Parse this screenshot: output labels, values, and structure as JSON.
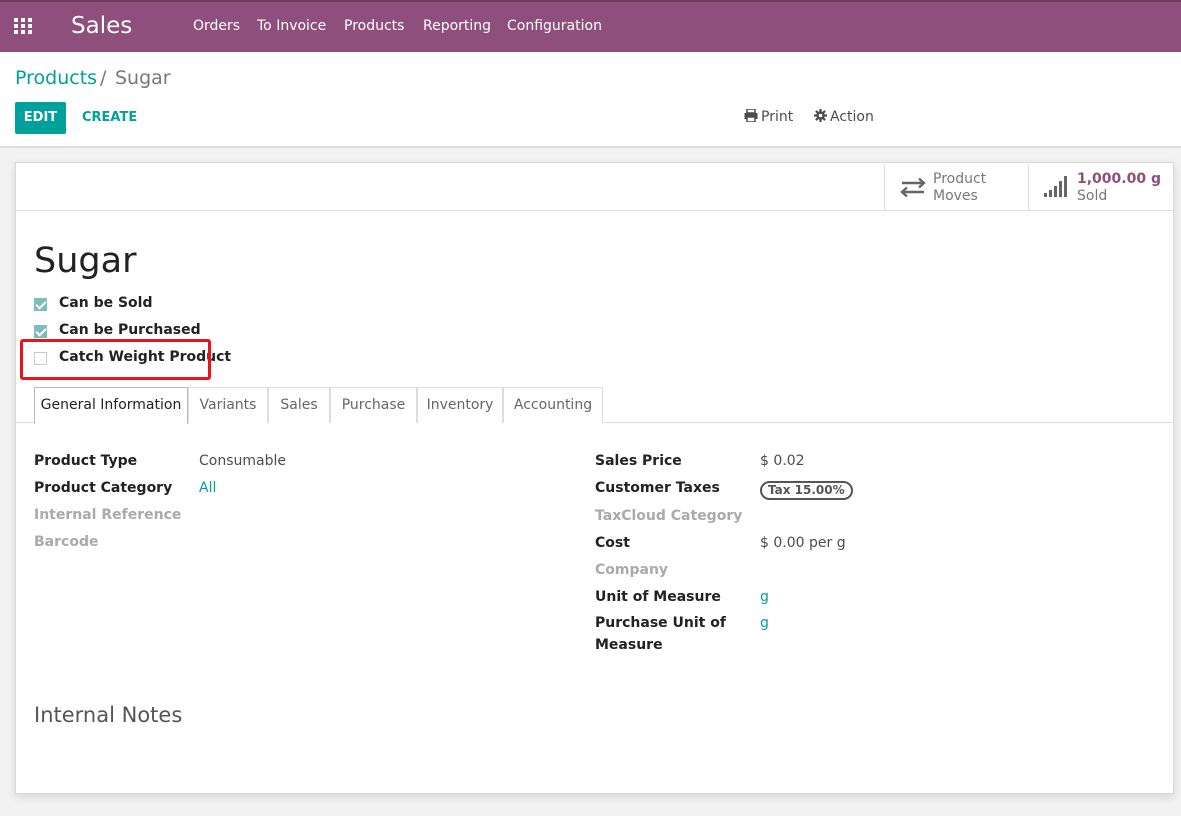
{
  "navbar": {
    "brand": "Sales",
    "menu": [
      "Orders",
      "To Invoice",
      "Products",
      "Reporting",
      "Configuration"
    ],
    "color": "#8f4f7c"
  },
  "breadcrumb": {
    "parent": "Products",
    "separator": "/",
    "current": "Sugar"
  },
  "buttons": {
    "edit": "EDIT",
    "create": "CREATE",
    "print": "Print",
    "action": "Action"
  },
  "smart_buttons": {
    "moves": {
      "line1": "Product",
      "line2": "Moves",
      "icon": "exchange-icon"
    },
    "sold": {
      "value": "1,000.00 g",
      "label": "Sold",
      "icon": "signal-bars-icon"
    }
  },
  "product": {
    "name": "Sugar",
    "checkboxes": [
      {
        "label": "Can be Sold",
        "checked": true
      },
      {
        "label": "Can be Purchased",
        "checked": true
      },
      {
        "label": "Catch Weight Product",
        "checked": false
      }
    ]
  },
  "tabs": [
    "General Information",
    "Variants",
    "Sales",
    "Purchase",
    "Inventory",
    "Accounting"
  ],
  "left_fields": [
    {
      "label": "Product Type",
      "value": "Consumable"
    },
    {
      "label": "Product Category",
      "value": "All"
    },
    {
      "label": "Internal Reference",
      "value": ""
    },
    {
      "label": "Barcode",
      "value": ""
    }
  ],
  "right_fields": {
    "sales_price": {
      "label": "Sales Price",
      "value": "$ 0.02"
    },
    "customer_taxes": {
      "label": "Customer Taxes",
      "value": "Tax 15.00%"
    },
    "taxcloud": {
      "label": "TaxCloud Category",
      "value": ""
    },
    "cost": {
      "label": "Cost",
      "value": "$ 0.00",
      "unit": "per g"
    },
    "company": {
      "label": "Company",
      "value": ""
    },
    "uom": {
      "label": "Unit of Measure",
      "value": "g"
    },
    "purchase_uom": {
      "label_line1": "Purchase Unit of",
      "label_line2": "Measure",
      "value": "g"
    }
  },
  "notes": {
    "title": "Internal Notes"
  },
  "colors": {
    "accent": "#00a09d",
    "highlight": "#e8141b"
  }
}
